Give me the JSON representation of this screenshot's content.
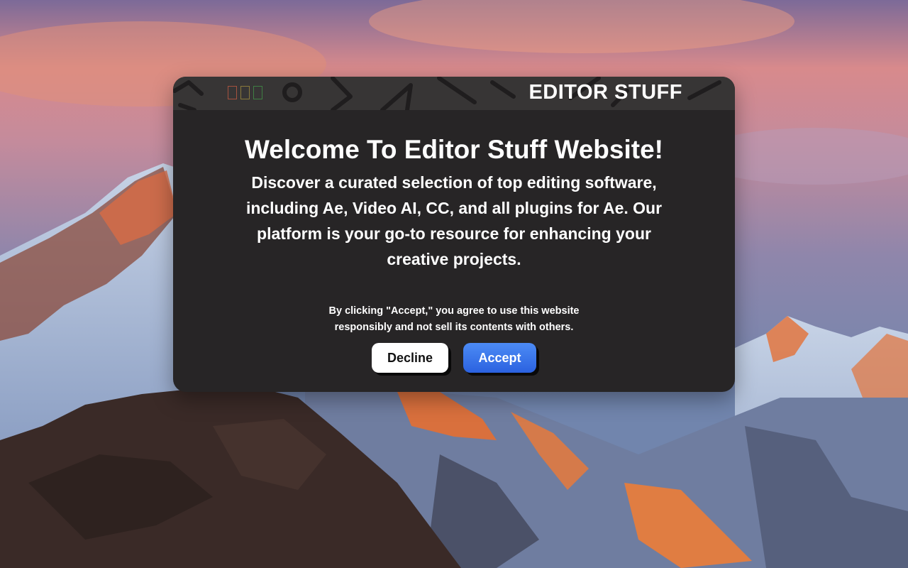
{
  "window": {
    "brand": "EDITOR STUFF",
    "controls": [
      {
        "name": "close",
        "color": "#a4523f"
      },
      {
        "name": "minimize",
        "color": "#8a7a3c"
      },
      {
        "name": "maximize",
        "color": "#3f7f43"
      }
    ]
  },
  "welcome": {
    "headline": "Welcome To Editor Stuff Website!",
    "description": "Discover a curated selection of top editing software, including Ae, Video AI, CC, and all plugins for Ae. Our platform is your go-to resource for enhancing your creative projects.",
    "consent_notice": "By clicking \"Accept,\" you agree to use this website responsibly and not sell its contents with others."
  },
  "actions": {
    "decline_label": "Decline",
    "accept_label": "Accept"
  },
  "colors": {
    "window_bg": "#272526",
    "titlebar_bg": "#373535",
    "accept_button": "#3a76ee",
    "decline_button": "#ffffff"
  }
}
